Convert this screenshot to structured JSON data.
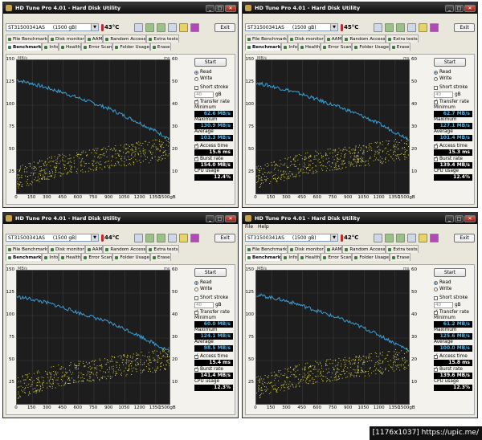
{
  "windows": [
    {
      "title": "HD Tune Pro 4.01 - Hard Disk Utility",
      "menu": [],
      "drive": "ST31500341AS",
      "capacity": "(1500 gB)",
      "temperature": "43°C",
      "exit_label": "Exit",
      "tabs_row1": [
        "File Benchmark",
        "Disk monitor",
        "AAM",
        "Random Access",
        "Extra tests"
      ],
      "tabs_row2": [
        "Benchmark",
        "Info",
        "Health",
        "Error Scan",
        "Folder Usage",
        "Erase"
      ],
      "start_label": "Start",
      "read_label": "Read",
      "write_label": "Write",
      "short_stroke_label": "Short stroke",
      "short_stroke_value": "40",
      "short_stroke_unit": "gB",
      "transfer_rate_label": "Transfer rate",
      "minimum_label": "Minimum",
      "minimum": "62.6 MB/s",
      "maximum_label": "Maximum",
      "maximum": "130.9 MB/s",
      "average_label": "Average",
      "average": "103.3 MB/s",
      "access_time_label": "Access time",
      "access_time": "15.6 ms",
      "burst_rate_label": "Burst rate",
      "burst_rate": "154.0 MB/s",
      "cpu_usage_label": "CPU usage",
      "cpu_usage": "12.4%"
    },
    {
      "title": "HD Tune Pro 4.01 - Hard Disk Utility",
      "menu": [],
      "drive": "ST31500341AS",
      "capacity": "(1500 gB)",
      "temperature": "45°C",
      "exit_label": "Exit",
      "tabs_row1": [
        "File Benchmark",
        "Disk monitor",
        "AAM",
        "Random Access",
        "Extra tests"
      ],
      "tabs_row2": [
        "Benchmark",
        "Info",
        "Health",
        "Error Scan",
        "Folder Usage",
        "Erase"
      ],
      "start_label": "Start",
      "read_label": "Read",
      "write_label": "Write",
      "short_stroke_label": "Short stroke",
      "short_stroke_value": "40",
      "short_stroke_unit": "gB",
      "transfer_rate_label": "Transfer rate",
      "minimum_label": "Minimum",
      "minimum": "62.7 MB/s",
      "maximum_label": "Maximum",
      "maximum": "127.1 MB/s",
      "average_label": "Average",
      "average": "101.4 MB/s",
      "access_time_label": "Access time",
      "access_time": "15.3 ms",
      "burst_rate_label": "Burst rate",
      "burst_rate": "139.4 MB/s",
      "cpu_usage_label": "CPU usage",
      "cpu_usage": "12.4%"
    },
    {
      "title": "HD Tune Pro 4.01 - Hard Disk Utility",
      "menu": [],
      "drive": "ST31500341AS",
      "capacity": "(1500 gB)",
      "temperature": "44°C",
      "exit_label": "Exit",
      "tabs_row1": [
        "File Benchmark",
        "Disk monitor",
        "AAM",
        "Random Access",
        "Extra tests"
      ],
      "tabs_row2": [
        "Benchmark",
        "Info",
        "Health",
        "Error Scan",
        "Folder Usage",
        "Erase"
      ],
      "start_label": "Start",
      "read_label": "Read",
      "write_label": "Write",
      "short_stroke_label": "Short stroke",
      "short_stroke_value": "40",
      "short_stroke_unit": "gB",
      "transfer_rate_label": "Transfer rate",
      "minimum_label": "Minimum",
      "minimum": "60.0 MB/s",
      "maximum_label": "Maximum",
      "maximum": "124.1 MB/s",
      "average_label": "Average",
      "average": "98.5 MB/s",
      "access_time_label": "Access time",
      "access_time": "15.4 ms",
      "burst_rate_label": "Burst rate",
      "burst_rate": "141.4 MB/s",
      "cpu_usage_label": "CPU usage",
      "cpu_usage": "12.3%"
    },
    {
      "title": "HD Tune Pro 4.01 - Hard Disk Utility",
      "menu": [
        "File",
        "Help"
      ],
      "drive": "ST31500341AS",
      "capacity": "(1500 gB)",
      "temperature": "42°C",
      "exit_label": "Exit",
      "tabs_row1": [
        "File Benchmark",
        "Disk monitor",
        "AAM",
        "Random Access",
        "Extra tests"
      ],
      "tabs_row2": [
        "Benchmark",
        "Info",
        "Health",
        "Error Scan",
        "Folder Usage",
        "Erase"
      ],
      "start_label": "Start",
      "read_label": "Read",
      "write_label": "Write",
      "short_stroke_label": "Short stroke",
      "short_stroke_value": "40",
      "short_stroke_unit": "gB",
      "transfer_rate_label": "Transfer rate",
      "minimum_label": "Minimum",
      "minimum": "61.2 MB/s",
      "maximum_label": "Maximum",
      "maximum": "125.6 MB/s",
      "average_label": "Average",
      "average": "100.0 MB/s",
      "access_time_label": "Access time",
      "access_time": "15.8 ms",
      "burst_rate_label": "Burst rate",
      "burst_rate": "139.6 MB/s",
      "cpu_usage_label": "CPU usage",
      "cpu_usage": "12.3%"
    }
  ],
  "chart_data": [
    {
      "type": "line",
      "x_unit": "MB/s-left",
      "x": [
        0,
        150,
        300,
        450,
        600,
        750,
        900,
        1050,
        1200,
        1350,
        1500
      ],
      "xlabel": "",
      "ylabel": "MB/s",
      "y2label": "ms",
      "xlim": [
        0,
        1500
      ],
      "ylim": [
        0,
        150
      ],
      "y2lim": [
        0,
        60
      ],
      "series": [
        {
          "values": [
            128,
            124,
            119,
            114,
            108,
            102,
            96,
            88,
            80,
            71,
            62
          ],
          "color": "#3aa0d8"
        },
        {
          "values": [
            8,
            10,
            12,
            14,
            15,
            16,
            17,
            18,
            19,
            20,
            21
          ],
          "color": "#d8d040"
        }
      ]
    },
    {
      "type": "line",
      "x": [
        0,
        150,
        300,
        450,
        600,
        750,
        900,
        1050,
        1200,
        1350,
        1500
      ],
      "xlabel": "",
      "ylabel": "MB/s",
      "y2label": "ms",
      "xlim": [
        0,
        1500
      ],
      "ylim": [
        0,
        150
      ],
      "y2lim": [
        0,
        60
      ],
      "series": [
        {
          "values": [
            125,
            121,
            117,
            112,
            106,
            100,
            94,
            87,
            79,
            70,
            62
          ],
          "color": "#3aa0d8"
        },
        {
          "values": [
            8,
            10,
            12,
            14,
            15,
            16,
            17,
            18,
            19,
            20,
            21
          ],
          "color": "#d8d040"
        }
      ]
    },
    {
      "type": "line",
      "x": [
        0,
        150,
        300,
        450,
        600,
        750,
        900,
        1050,
        1200,
        1350,
        1500
      ],
      "xlabel": "",
      "ylabel": "MB/s",
      "y2label": "ms",
      "xlim": [
        0,
        1500
      ],
      "ylim": [
        0,
        150
      ],
      "y2lim": [
        0,
        60
      ],
      "series": [
        {
          "values": [
            121,
            118,
            114,
            109,
            103,
            98,
            92,
            85,
            77,
            68,
            60
          ],
          "color": "#3aa0d8"
        },
        {
          "values": [
            8,
            10,
            12,
            14,
            15,
            16,
            17,
            18,
            19,
            20,
            21
          ],
          "color": "#d8d040"
        }
      ]
    },
    {
      "type": "line",
      "x": [
        0,
        150,
        300,
        450,
        600,
        750,
        900,
        1050,
        1200,
        1350,
        1500
      ],
      "xlabel": "",
      "ylabel": "MB/s",
      "y2label": "ms",
      "xlim": [
        0,
        1500
      ],
      "ylim": [
        0,
        150
      ],
      "y2lim": [
        0,
        60
      ],
      "series": [
        {
          "values": [
            123,
            120,
            116,
            111,
            105,
            99,
            93,
            86,
            78,
            69,
            61
          ],
          "color": "#3aa0d8"
        },
        {
          "values": [
            8,
            10,
            12,
            14,
            15,
            16,
            17,
            18,
            19,
            20,
            21
          ],
          "color": "#d8d040"
        }
      ]
    }
  ],
  "axis": {
    "y_ticks": [
      150,
      125,
      100,
      75,
      50,
      25
    ],
    "y2_ticks": [
      60,
      50,
      40,
      30,
      20,
      10
    ],
    "x_ticks": [
      "0",
      "150",
      "300",
      "450",
      "600",
      "750",
      "900",
      "1050",
      "1200",
      "1350",
      "1500gB"
    ],
    "y_unit": "MB/s",
    "y2_unit": "ms"
  },
  "footer_logo": "[1176x1037] https://upic.me/"
}
